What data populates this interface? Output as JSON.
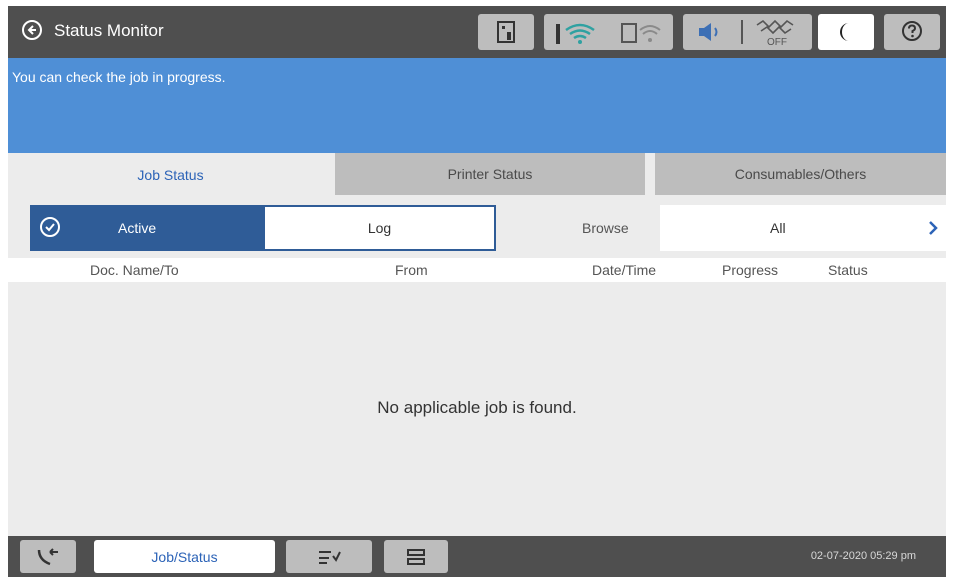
{
  "header": {
    "title": "Status Monitor",
    "toolbar": {
      "wireless_off_label": "OFF"
    }
  },
  "message": "You can check the job in progress.",
  "tabs": [
    {
      "label": "Job Status",
      "active": true
    },
    {
      "label": "Printer Status",
      "active": false
    },
    {
      "label": "Consumables/Others",
      "active": false
    }
  ],
  "filter": {
    "active_label": "Active",
    "log_label": "Log",
    "browse_label": "Browse",
    "browse_value": "All"
  },
  "columns": [
    "Doc. Name/To",
    "From",
    "Date/Time",
    "Progress",
    "Status"
  ],
  "empty_message": "No applicable job is found.",
  "footer": {
    "job_status_label": "Job/Status",
    "datetime": "02-07-2020 05:29 pm"
  },
  "colors": {
    "topbar": "#4f4f4f",
    "message_bar": "#4f8fd6",
    "accent": "#2f5c97",
    "tab_text_active": "#2c63b7"
  },
  "icons": [
    "back-icon",
    "printer-memory-icon",
    "wifi-icon",
    "wifi-direct-icon",
    "volume-icon",
    "quiet-off-icon",
    "sleep-moon-icon",
    "help-icon",
    "check-circle-icon",
    "chevron-right-icon",
    "fax-icon",
    "job-queue-icon",
    "eject-tray-icon"
  ]
}
